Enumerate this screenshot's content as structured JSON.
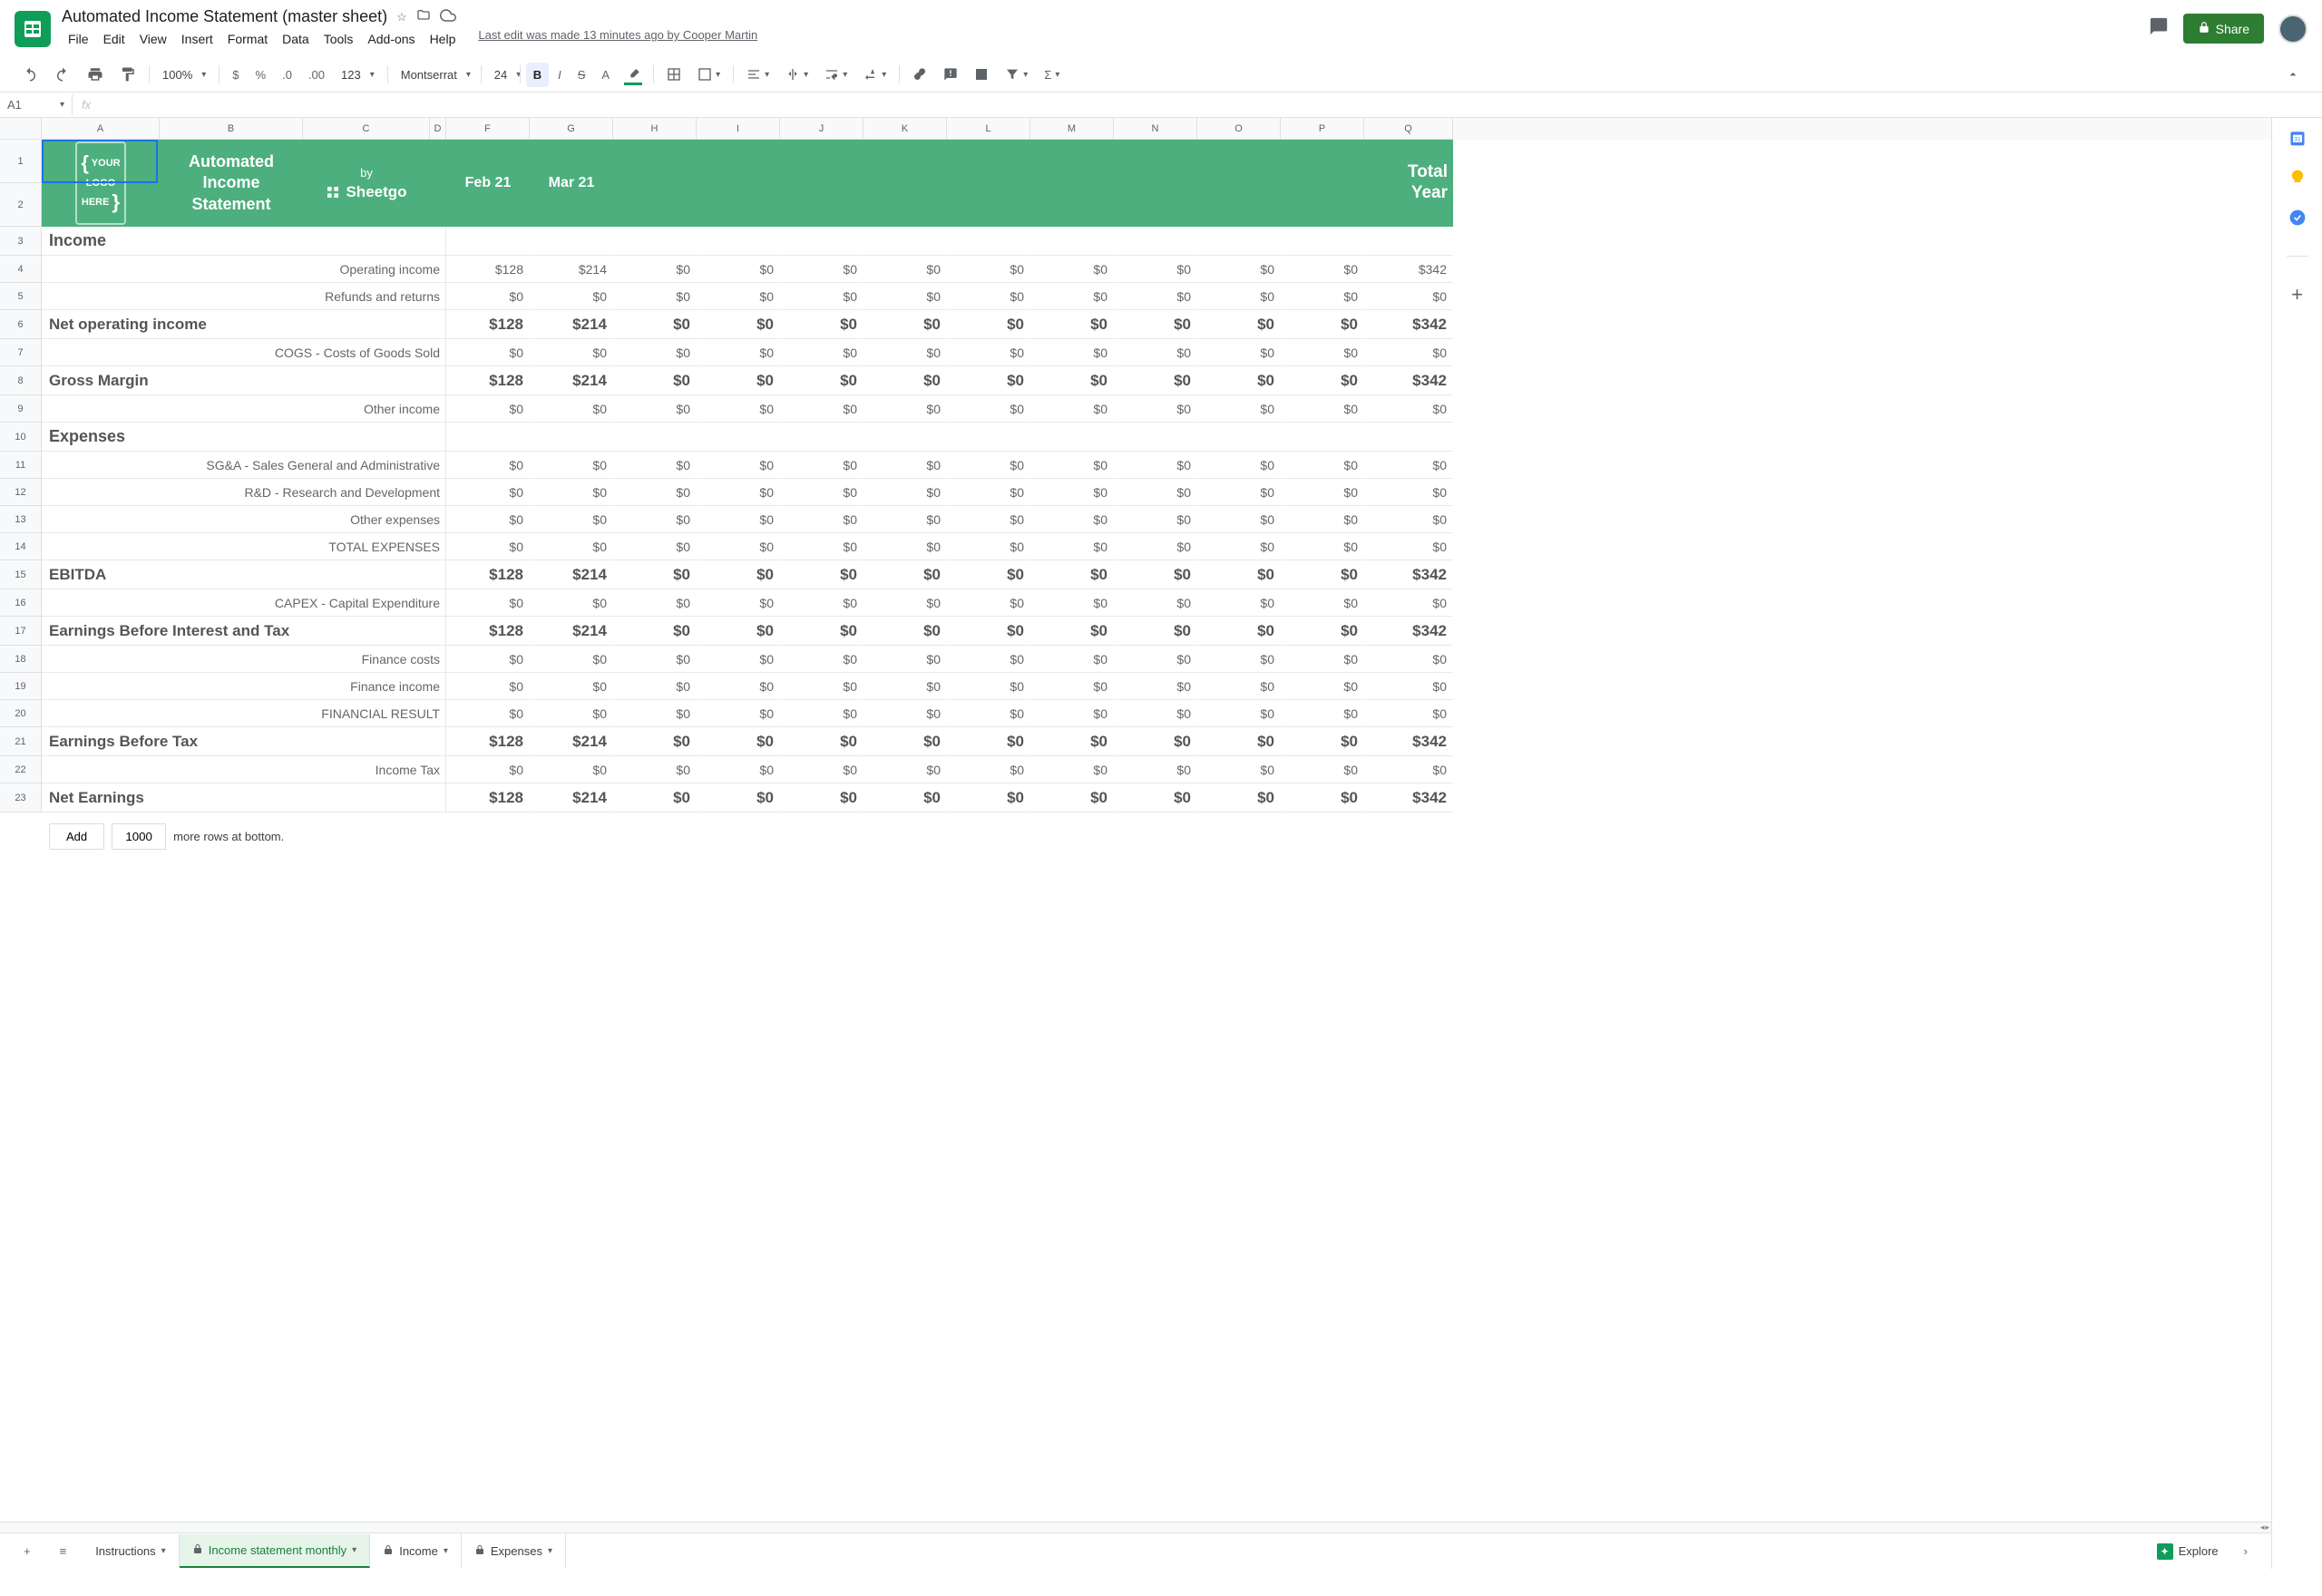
{
  "doc_title": "Automated Income Statement (master sheet)",
  "last_edit": "Last edit was made 13 minutes ago by Cooper Martin",
  "share_label": "Share",
  "menus": [
    "File",
    "Edit",
    "View",
    "Insert",
    "Format",
    "Data",
    "Tools",
    "Add-ons",
    "Help"
  ],
  "toolbar": {
    "zoom": "100%",
    "format_num": "123",
    "font": "Montserrat",
    "font_size": "24"
  },
  "name_box": "A1",
  "columns": [
    "A",
    "B",
    "C",
    "D",
    "F",
    "G",
    "H",
    "I",
    "J",
    "K",
    "L",
    "M",
    "N",
    "O",
    "P",
    "Q"
  ],
  "header_row": {
    "logo": "{ YOUR LOGO HERE }",
    "title": "Automated Income Statement",
    "by": "by",
    "sheetgo": "Sheetgo",
    "months": [
      "Feb 21",
      "Mar 21",
      "",
      "",
      "",
      "",
      "",
      "",
      "",
      "",
      ""
    ],
    "total_label": "Total Year"
  },
  "rows": [
    {
      "n": 3,
      "type": "section",
      "label": "Income",
      "vals": null
    },
    {
      "n": 4,
      "type": "normal",
      "label": "Operating income",
      "vals": [
        "$128",
        "$214",
        "$0",
        "$0",
        "$0",
        "$0",
        "$0",
        "$0",
        "$0",
        "$0",
        "$0",
        "$342"
      ]
    },
    {
      "n": 5,
      "type": "normal",
      "label": "Refunds and returns",
      "vals": [
        "$0",
        "$0",
        "$0",
        "$0",
        "$0",
        "$0",
        "$0",
        "$0",
        "$0",
        "$0",
        "$0",
        "$0"
      ]
    },
    {
      "n": 6,
      "type": "bold",
      "label": "Net operating income",
      "vals": [
        "$128",
        "$214",
        "$0",
        "$0",
        "$0",
        "$0",
        "$0",
        "$0",
        "$0",
        "$0",
        "$0",
        "$342"
      ]
    },
    {
      "n": 7,
      "type": "normal",
      "label": "COGS - Costs of Goods Sold",
      "vals": [
        "$0",
        "$0",
        "$0",
        "$0",
        "$0",
        "$0",
        "$0",
        "$0",
        "$0",
        "$0",
        "$0",
        "$0"
      ]
    },
    {
      "n": 8,
      "type": "bold",
      "label": "Gross Margin",
      "vals": [
        "$128",
        "$214",
        "$0",
        "$0",
        "$0",
        "$0",
        "$0",
        "$0",
        "$0",
        "$0",
        "$0",
        "$342"
      ]
    },
    {
      "n": 9,
      "type": "normal",
      "label": "Other income",
      "vals": [
        "$0",
        "$0",
        "$0",
        "$0",
        "$0",
        "$0",
        "$0",
        "$0",
        "$0",
        "$0",
        "$0",
        "$0"
      ]
    },
    {
      "n": 10,
      "type": "section",
      "label": "Expenses",
      "vals": null
    },
    {
      "n": 11,
      "type": "normal",
      "label": "SG&A - Sales General and Administrative",
      "vals": [
        "$0",
        "$0",
        "$0",
        "$0",
        "$0",
        "$0",
        "$0",
        "$0",
        "$0",
        "$0",
        "$0",
        "$0"
      ]
    },
    {
      "n": 12,
      "type": "normal",
      "label": "R&D - Research and Development",
      "vals": [
        "$0",
        "$0",
        "$0",
        "$0",
        "$0",
        "$0",
        "$0",
        "$0",
        "$0",
        "$0",
        "$0",
        "$0"
      ]
    },
    {
      "n": 13,
      "type": "normal",
      "label": "Other expenses",
      "vals": [
        "$0",
        "$0",
        "$0",
        "$0",
        "$0",
        "$0",
        "$0",
        "$0",
        "$0",
        "$0",
        "$0",
        "$0"
      ]
    },
    {
      "n": 14,
      "type": "normal",
      "label": "TOTAL EXPENSES",
      "vals": [
        "$0",
        "$0",
        "$0",
        "$0",
        "$0",
        "$0",
        "$0",
        "$0",
        "$0",
        "$0",
        "$0",
        "$0"
      ]
    },
    {
      "n": 15,
      "type": "bold",
      "label": "EBITDA",
      "vals": [
        "$128",
        "$214",
        "$0",
        "$0",
        "$0",
        "$0",
        "$0",
        "$0",
        "$0",
        "$0",
        "$0",
        "$342"
      ]
    },
    {
      "n": 16,
      "type": "normal",
      "label": "CAPEX - Capital Expenditure",
      "vals": [
        "$0",
        "$0",
        "$0",
        "$0",
        "$0",
        "$0",
        "$0",
        "$0",
        "$0",
        "$0",
        "$0",
        "$0"
      ]
    },
    {
      "n": 17,
      "type": "bold",
      "label": "Earnings Before Interest and Tax",
      "vals": [
        "$128",
        "$214",
        "$0",
        "$0",
        "$0",
        "$0",
        "$0",
        "$0",
        "$0",
        "$0",
        "$0",
        "$342"
      ]
    },
    {
      "n": 18,
      "type": "normal",
      "label": "Finance costs",
      "vals": [
        "$0",
        "$0",
        "$0",
        "$0",
        "$0",
        "$0",
        "$0",
        "$0",
        "$0",
        "$0",
        "$0",
        "$0"
      ]
    },
    {
      "n": 19,
      "type": "normal",
      "label": "Finance income",
      "vals": [
        "$0",
        "$0",
        "$0",
        "$0",
        "$0",
        "$0",
        "$0",
        "$0",
        "$0",
        "$0",
        "$0",
        "$0"
      ]
    },
    {
      "n": 20,
      "type": "normal",
      "label": "FINANCIAL RESULT",
      "vals": [
        "$0",
        "$0",
        "$0",
        "$0",
        "$0",
        "$0",
        "$0",
        "$0",
        "$0",
        "$0",
        "$0",
        "$0"
      ]
    },
    {
      "n": 21,
      "type": "bold",
      "label": "Earnings Before Tax",
      "vals": [
        "$128",
        "$214",
        "$0",
        "$0",
        "$0",
        "$0",
        "$0",
        "$0",
        "$0",
        "$0",
        "$0",
        "$342"
      ]
    },
    {
      "n": 22,
      "type": "normal",
      "label": "Income Tax",
      "vals": [
        "$0",
        "$0",
        "$0",
        "$0",
        "$0",
        "$0",
        "$0",
        "$0",
        "$0",
        "$0",
        "$0",
        "$0"
      ]
    },
    {
      "n": 23,
      "type": "bold",
      "label": "Net Earnings",
      "vals": [
        "$128",
        "$214",
        "$0",
        "$0",
        "$0",
        "$0",
        "$0",
        "$0",
        "$0",
        "$0",
        "$0",
        "$342"
      ]
    }
  ],
  "add_rows": {
    "btn": "Add",
    "count": "1000",
    "text": "more rows at bottom."
  },
  "sheet_tabs": [
    {
      "name": "Instructions",
      "active": false,
      "locked": false
    },
    {
      "name": "Income statement monthly",
      "active": true,
      "locked": true
    },
    {
      "name": "Income",
      "active": false,
      "locked": true
    },
    {
      "name": "Expenses",
      "active": false,
      "locked": true
    }
  ],
  "explore": "Explore"
}
